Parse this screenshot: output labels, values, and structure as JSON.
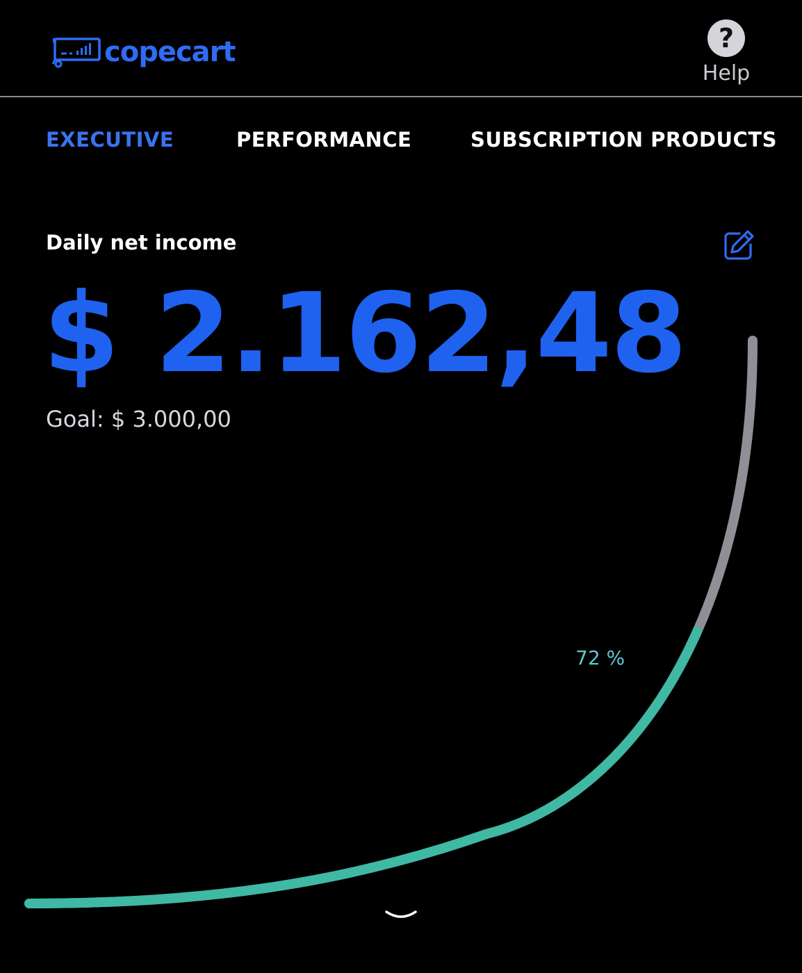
{
  "header": {
    "brand": "copecart",
    "help_label": "Help",
    "help_glyph": "?"
  },
  "tabs": [
    {
      "label": "EXECUTIVE",
      "active": true
    },
    {
      "label": "PERFORMANCE",
      "active": false
    },
    {
      "label": "SUBSCRIPTION PRODUCTS",
      "active": false
    }
  ],
  "income": {
    "label": "Daily net income",
    "amount": "$ 2.162,48",
    "goal": "Goal: $ 3.000,00"
  },
  "gauge": {
    "progress": 0.72,
    "percent_label": "72 %",
    "colors": {
      "filled": "#3fb8a4",
      "remaining": "#8e8f97"
    }
  },
  "colors": {
    "accent": "#2f6cf6",
    "background": "#000000"
  },
  "icons": {
    "logo": "cart-chart-icon",
    "help": "question-circle-icon",
    "edit": "pencil-square-icon",
    "expand": "chevron-down-icon"
  }
}
